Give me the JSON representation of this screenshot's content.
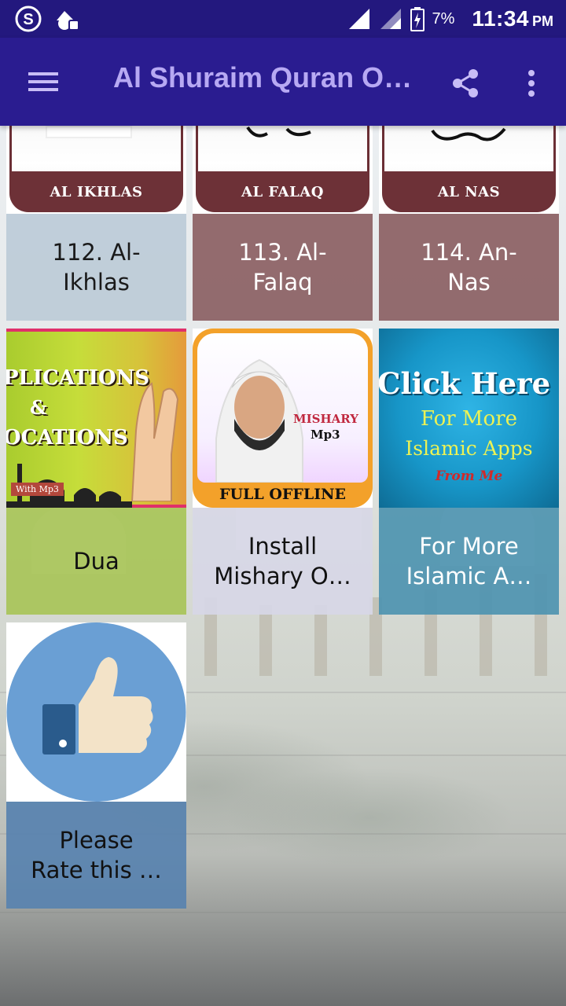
{
  "status_bar": {
    "battery_percent": "7%",
    "time": "11:34",
    "ampm": "PM",
    "icons": [
      "swiftkey-s-icon",
      "lock-notification-icon",
      "signal-icon",
      "signal-icon-2",
      "battery-charging-icon"
    ]
  },
  "app_bar": {
    "title": "Al Shuraim Quran Offline",
    "menu_icon": "hamburger-menu-icon",
    "share_icon": "share-icon",
    "overflow_icon": "more-vert-icon"
  },
  "colors": {
    "status_bar": "#23187e",
    "app_bar": "#2a1c90",
    "title": "#b7a9f3"
  },
  "tiles": [
    {
      "image_label": "AL IKHLAS",
      "label_line1": "112. Al-",
      "label_line2": "Ikhlas"
    },
    {
      "image_label": "AL FALAQ",
      "label_line1": "113. Al-",
      "label_line2": "Falaq"
    },
    {
      "image_label": "AL NAS",
      "label_line1": "114. An-",
      "label_line2": "Nas"
    },
    {
      "image_text1": "PLICATIONS",
      "image_text2": "&",
      "image_text3": "OCATIONS",
      "image_badge": "With Mp3",
      "label_line1": "Dua",
      "label_line2": ""
    },
    {
      "image_text1": "MISHARY",
      "image_text2": "Mp3",
      "image_text3": "FULL OFFLINE",
      "label_line1": "Install",
      "label_line2": "Mishary O…"
    },
    {
      "image_text1": "Click Here",
      "image_text2": "For More",
      "image_text3": "Islamic Apps",
      "image_text4": "From Me",
      "label_line1": "For More",
      "label_line2": "Islamic A…"
    },
    {
      "image_icon": "thumbs-up-icon",
      "label_line1": "Please",
      "label_line2": "Rate this …"
    }
  ]
}
